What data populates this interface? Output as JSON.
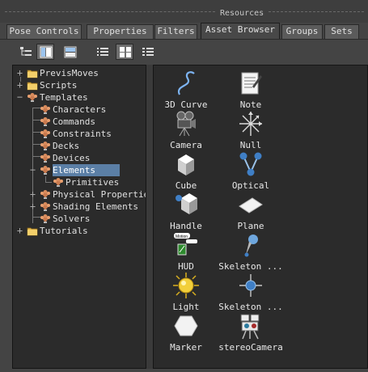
{
  "window": {
    "title": "Resources"
  },
  "tabs": [
    {
      "label": "Pose Controls"
    },
    {
      "label": "Properties"
    },
    {
      "label": "Filters"
    },
    {
      "label": "Asset Browser",
      "active": true
    },
    {
      "label": "Groups"
    },
    {
      "label": "Sets"
    }
  ],
  "toolbar": {
    "buttons": [
      {
        "icon": "tree-view-icon",
        "on": false
      },
      {
        "icon": "split-vertical-icon",
        "on": true
      },
      {
        "icon": "split-horizontal-icon",
        "on": false
      },
      {
        "icon": "list-view-icon",
        "on": false
      },
      {
        "icon": "grid-view-icon",
        "on": true
      },
      {
        "icon": "detail-view-icon",
        "on": false
      }
    ]
  },
  "tree": {
    "items": [
      {
        "label": "PrevisMoves",
        "icon": "folder-icon",
        "expander": "+"
      },
      {
        "label": "Scripts",
        "icon": "folder-icon",
        "expander": "+"
      },
      {
        "label": "Templates",
        "icon": "template-folder-icon",
        "expander": "−"
      },
      {
        "label": "Characters",
        "icon": "template-folder-icon",
        "expander": ""
      },
      {
        "label": "Commands",
        "icon": "template-folder-icon",
        "expander": ""
      },
      {
        "label": "Constraints",
        "icon": "template-folder-icon",
        "expander": ""
      },
      {
        "label": "Decks",
        "icon": "template-folder-icon",
        "expander": ""
      },
      {
        "label": "Devices",
        "icon": "template-folder-icon",
        "expander": ""
      },
      {
        "label": "Elements",
        "icon": "template-folder-icon",
        "expander": "−",
        "selected": true
      },
      {
        "label": "Primitives",
        "icon": "template-folder-icon",
        "expander": ""
      },
      {
        "label": "Physical Properties",
        "icon": "template-folder-icon",
        "expander": "+"
      },
      {
        "label": "Shading Elements",
        "icon": "template-folder-icon",
        "expander": "+"
      },
      {
        "label": "Solvers",
        "icon": "template-folder-icon",
        "expander": ""
      },
      {
        "label": "Tutorials",
        "icon": "folder-icon",
        "expander": "+"
      }
    ]
  },
  "assets": [
    {
      "label": "3D Curve",
      "icon": "curve-icon"
    },
    {
      "label": "Note",
      "icon": "note-icon"
    },
    {
      "label": "Camera",
      "icon": "camera-icon"
    },
    {
      "label": "Null",
      "icon": "null-icon"
    },
    {
      "label": "Cube",
      "icon": "cube-icon"
    },
    {
      "label": "Optical",
      "icon": "optical-icon"
    },
    {
      "label": "Handle",
      "icon": "handle-icon"
    },
    {
      "label": "Plane",
      "icon": "plane-icon"
    },
    {
      "label": "HUD",
      "icon": "hud-icon"
    },
    {
      "label": "Skeleton ...",
      "icon": "skeleton-icon"
    },
    {
      "label": "Light",
      "icon": "light-icon"
    },
    {
      "label": "Skeleton ...",
      "icon": "skeleton-node-icon"
    },
    {
      "label": "Marker",
      "icon": "marker-icon"
    },
    {
      "label": "stereoCamera",
      "icon": "stereo-camera-icon"
    }
  ]
}
